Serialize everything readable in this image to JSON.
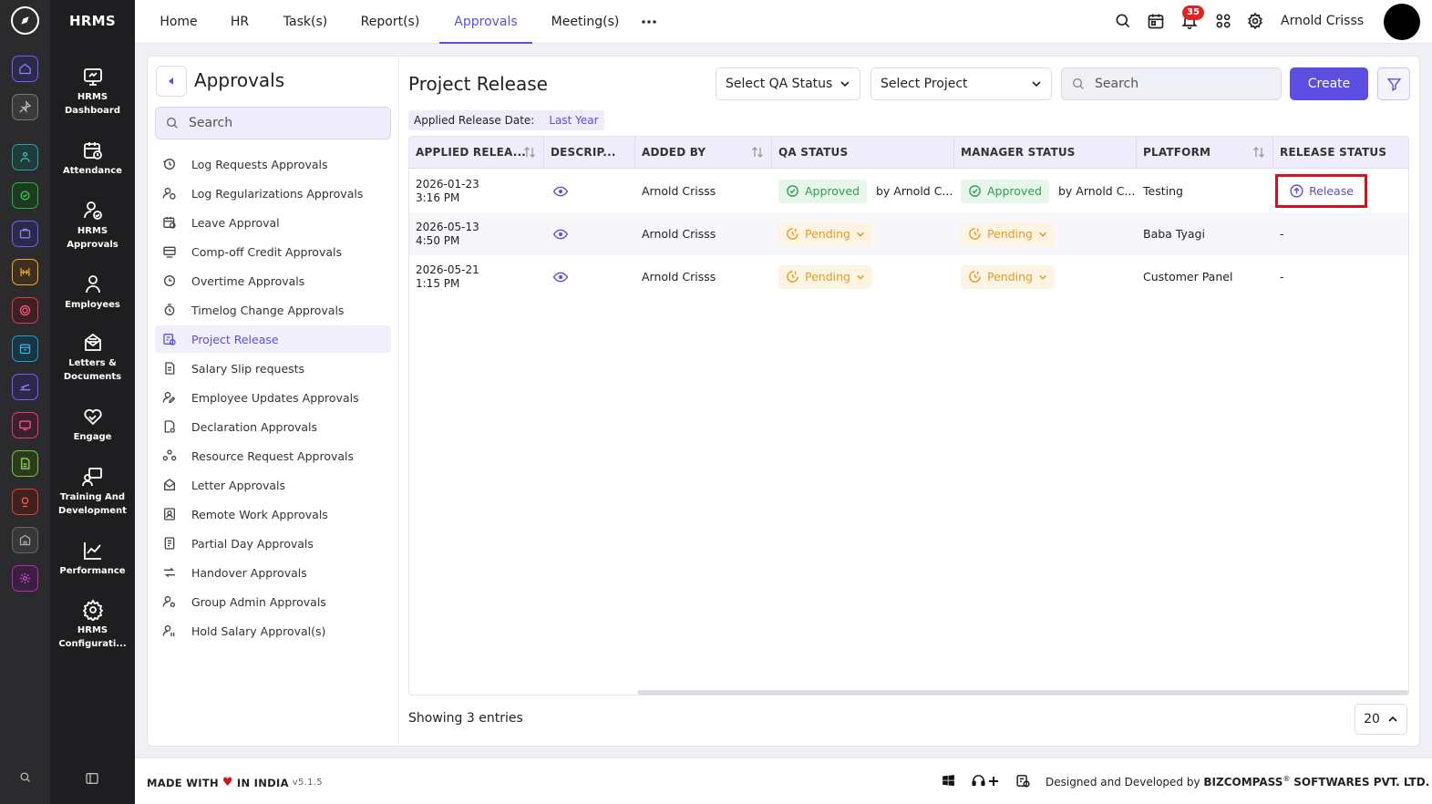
{
  "app": {
    "name": "HRMS"
  },
  "modules": [
    {
      "label": "HRMS Dashboard",
      "icon": "dashboard-icon"
    },
    {
      "label": "Attendance",
      "icon": "attendance-icon"
    },
    {
      "label": "HRMS Approvals",
      "icon": "approvals-icon"
    },
    {
      "label": "Employees",
      "icon": "employees-icon"
    },
    {
      "label": "Letters & Documents",
      "icon": "letters-icon"
    },
    {
      "label": "Engage",
      "icon": "engage-icon"
    },
    {
      "label": "Training And Development",
      "icon": "training-icon"
    },
    {
      "label": "Performance",
      "icon": "performance-icon"
    },
    {
      "label": "HRMS Configurati...",
      "icon": "configuration-icon"
    }
  ],
  "topnav": {
    "tabs": [
      "Home",
      "HR",
      "Task(s)",
      "Report(s)",
      "Approvals",
      "Meeting(s)"
    ],
    "active_tab": "Approvals",
    "notification_count": "35",
    "user_name": "Arnold Crisss"
  },
  "subnav": {
    "title": "Approvals",
    "search_placeholder": "Search",
    "items": [
      "Log Requests Approvals",
      "Log Regularizations Approvals",
      "Leave Approval",
      "Comp-off Credit Approvals",
      "Overtime Approvals",
      "Timelog Change Approvals",
      "Project Release",
      "Salary Slip requests",
      "Employee Updates Approvals",
      "Declaration Approvals",
      "Resource Request Approvals",
      "Letter Approvals",
      "Remote Work Approvals",
      "Partial Day Approvals",
      "Handover Approvals",
      "Group Admin Approvals",
      "Hold Salary Approval(s)"
    ],
    "active_item": "Project Release"
  },
  "main": {
    "title": "Project Release",
    "qa_status_select": "Select QA Status",
    "project_select": "Select Project",
    "search_placeholder": "Search",
    "create_label": "Create",
    "date_filter_label": "Applied Release Date:",
    "date_filter_value": "Last Year",
    "columns": [
      "APPLIED RELEA...",
      "DESCRIP...",
      "ADDED BY",
      "QA STATUS",
      "MANAGER STATUS",
      "PLATFORM",
      "RELEASE STATUS"
    ],
    "rows": [
      {
        "date": "2026-01-23",
        "time": "3:16 PM",
        "added_by": "Arnold Crisss",
        "qa_status": "Approved",
        "qa_by": "by Arnold C...",
        "manager_status": "Approved",
        "manager_by": "by Arnold C...",
        "platform": "Testing",
        "release_status": "Release"
      },
      {
        "date": "2026-05-13",
        "time": "4:50 PM",
        "added_by": "Arnold Crisss",
        "qa_status": "Pending",
        "qa_by": "",
        "manager_status": "Pending",
        "manager_by": "",
        "platform": "Baba Tyagi",
        "release_status": "-"
      },
      {
        "date": "2026-05-21",
        "time": "1:15 PM",
        "added_by": "Arnold Crisss",
        "qa_status": "Pending",
        "qa_by": "",
        "manager_status": "Pending",
        "manager_by": "",
        "platform": "Customer Panel",
        "release_status": "-"
      }
    ],
    "showing_text": "Showing 3 entries",
    "page_size": "20"
  },
  "footer": {
    "made_with": "MADE WITH",
    "in_india": "IN INDIA",
    "version": "v5.1.5",
    "designed_by": "Designed and Developed by",
    "company": "BIZCOMPASS",
    "company_suffix": "SOFTWARES PVT. LTD."
  },
  "colors": {
    "accent": "#5b4ee0",
    "approved": "#2e9d4a",
    "pending": "#e89a1f",
    "highlight": "#d6111b"
  }
}
